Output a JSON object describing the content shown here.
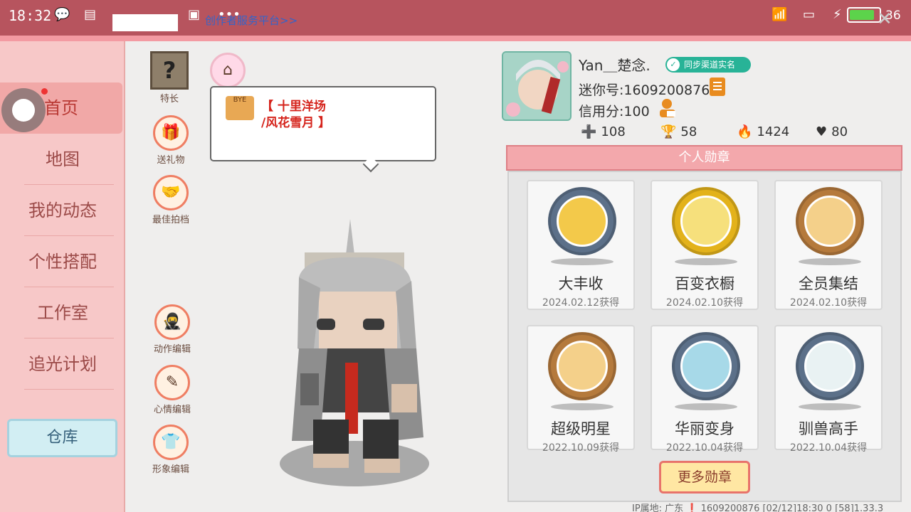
{
  "statusbar": {
    "time": "18:32",
    "promo": "创作者服务平台>>",
    "battery_level": "36",
    "accent_color": "#b7545e"
  },
  "sidebar": {
    "items": [
      {
        "label": "首页"
      },
      {
        "label": "地图"
      },
      {
        "label": "我的动态"
      },
      {
        "label": "个性搭配"
      },
      {
        "label": "工作室"
      },
      {
        "label": "追光计划"
      }
    ],
    "warehouse": "仓库"
  },
  "tools": {
    "specialty": "特长",
    "gift": "送礼物",
    "best_shot": "最佳拍档",
    "action_edit": "动作编辑",
    "mood_edit": "心情编辑",
    "image_edit": "形象编辑"
  },
  "bubble": {
    "line1": "【 十里洋场",
    "line2": "/风花雪月 】"
  },
  "profile": {
    "name": "Yan＿楚念.",
    "real_badge": "同步渠道实名",
    "mini_id": "迷你号:1609200876",
    "credit": "信用分:100",
    "stats": [
      {
        "icon": "plus-square-icon",
        "value": "108"
      },
      {
        "icon": "trophy-person-icon",
        "value": "58"
      },
      {
        "icon": "flame-icon",
        "value": "1424"
      },
      {
        "icon": "heart-icon",
        "value": "80"
      }
    ]
  },
  "medals": {
    "header": "个人勋章",
    "items": [
      {
        "name": "大丰收",
        "date": "2024.02.12获得",
        "ring": "#5c7089",
        "inner": "#f3c94a"
      },
      {
        "name": "百变衣橱",
        "date": "2024.02.10获得",
        "ring": "#e3b21b",
        "inner": "#f6e07c"
      },
      {
        "name": "全员集结",
        "date": "2024.02.10获得",
        "ring": "#b57a3c",
        "inner": "#f4d08a"
      },
      {
        "name": "超级明星",
        "date": "2022.10.09获得",
        "ring": "#b57a3c",
        "inner": "#f4d08a"
      },
      {
        "name": "华丽变身",
        "date": "2022.10.04获得",
        "ring": "#5c7089",
        "inner": "#a7d9e8"
      },
      {
        "name": "驯兽高手",
        "date": "2022.10.04获得",
        "ring": "#5c7089",
        "inner": "#e9f2f3"
      }
    ],
    "more": "更多勋章"
  },
  "footer": "IP属地: 广东 ❗     1609200876    [02/12]18:30 0   [58]1.33.3"
}
